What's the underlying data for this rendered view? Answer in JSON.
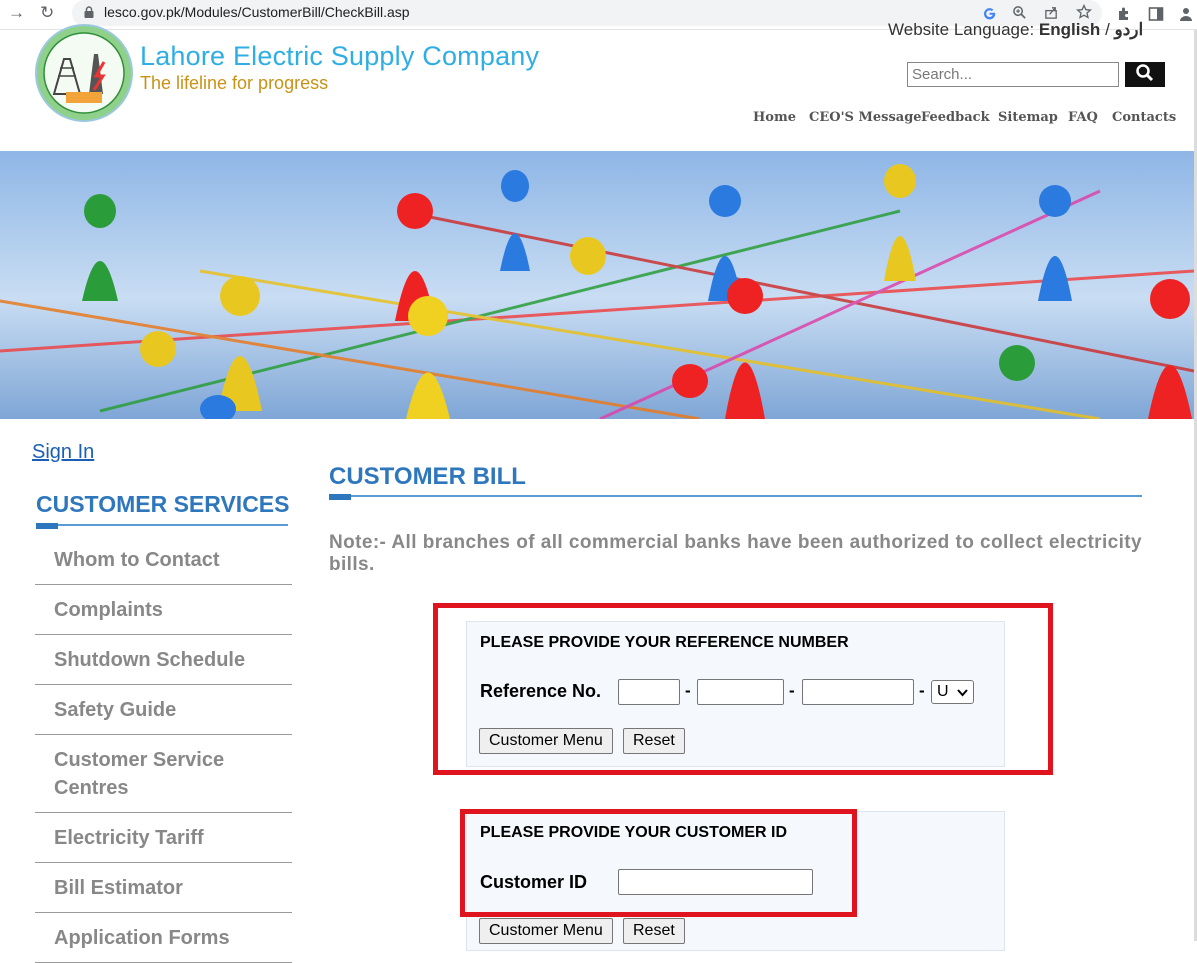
{
  "browser": {
    "url": "lesco.gov.pk/Modules/CustomerBill/CheckBill.asp"
  },
  "header": {
    "title": "Lahore Electric Supply Company",
    "tagline": "The lifeline for progress",
    "logo_text": "LESCO",
    "language_label": "Website Language:",
    "language_en": "English",
    "language_sep": "/",
    "language_ur": "اردو",
    "search_placeholder": "Search...",
    "nav": [
      "Home",
      "CEO'S Message",
      "Feedback",
      "Sitemap",
      "FAQ",
      "Contacts"
    ]
  },
  "sidebar": {
    "sign_in": "Sign In",
    "title": "CUSTOMER SERVICES",
    "items": [
      "Whom to Contact",
      "Complaints",
      "Shutdown Schedule",
      "Safety Guide",
      "Customer Service Centres",
      "Electricity Tariff",
      "Bill Estimator",
      "Application Forms"
    ]
  },
  "main": {
    "title": "CUSTOMER BILL",
    "note": "Note:- All branches of all commercial banks have been authorized to collect electricity bills.",
    "reference_form": {
      "heading": "PLEASE PROVIDE YOUR REFERENCE NUMBER",
      "label": "Reference No.",
      "dash": "-",
      "select_value": "U",
      "menu_button": "Customer Menu",
      "reset_button": "Reset"
    },
    "customer_form": {
      "heading": "PLEASE PROVIDE YOUR CUSTOMER ID",
      "label": "Customer ID",
      "menu_button": "Customer Menu",
      "reset_button": "Reset"
    }
  },
  "colors": {
    "brand_blue": "#2eaee3",
    "brand_gold": "#c99217",
    "heading_blue": "#2f77bd",
    "highlight_red": "#e0141e"
  }
}
